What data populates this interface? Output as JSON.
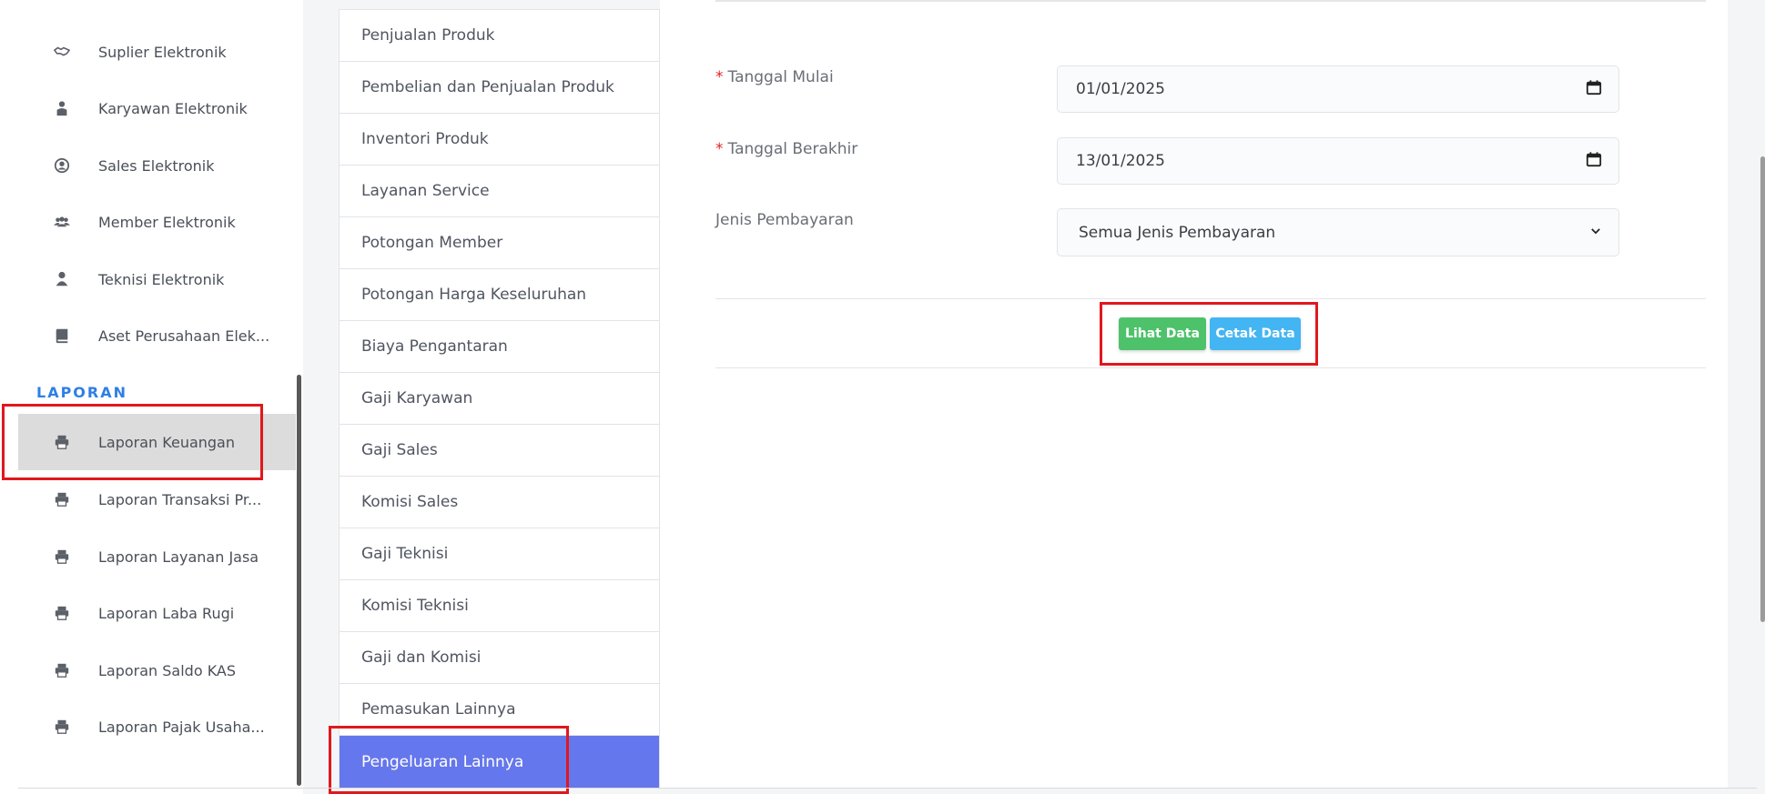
{
  "sidebar": {
    "section_label": "LAPORAN",
    "master_items": [
      {
        "label": "Suplier Elektronik",
        "icon": "handshake-icon"
      },
      {
        "label": "Karyawan Elektronik",
        "icon": "employee-icon"
      },
      {
        "label": "Sales Elektronik",
        "icon": "user-circle-icon"
      },
      {
        "label": "Member Elektronik",
        "icon": "users-icon"
      },
      {
        "label": "Teknisi Elektronik",
        "icon": "user-icon"
      },
      {
        "label": "Aset Perusahaan Elek...",
        "icon": "book-icon"
      }
    ],
    "report_items": [
      {
        "label": "Laporan Keuangan",
        "icon": "printer-icon",
        "active": true
      },
      {
        "label": "Laporan Transaksi Pr...",
        "icon": "printer-icon"
      },
      {
        "label": "Laporan Layanan Jasa",
        "icon": "printer-icon"
      },
      {
        "label": "Laporan Laba Rugi",
        "icon": "printer-icon"
      },
      {
        "label": "Laporan Saldo KAS",
        "icon": "printer-icon"
      },
      {
        "label": "Laporan Pajak Usaha...",
        "icon": "printer-icon"
      }
    ]
  },
  "report_list": {
    "items": [
      "Penjualan Produk",
      "Pembelian dan Penjualan Produk",
      "Inventori Produk",
      "Layanan Service",
      "Potongan Member",
      "Potongan Harga Keseluruhan",
      "Biaya Pengantaran",
      "Gaji Karyawan",
      "Gaji Sales",
      "Komisi Sales",
      "Gaji Teknisi",
      "Komisi Teknisi",
      "Gaji dan Komisi",
      "Pemasukan Lainnya",
      "Pengeluaran Lainnya"
    ],
    "active_item": "Pengeluaran Lainnya"
  },
  "form": {
    "required_mark": "*",
    "start_date_label": "Tanggal Mulai",
    "start_date_value": "01/01/2025",
    "end_date_label": "Tanggal Berakhir",
    "end_date_value": "13/01/2025",
    "payment_type_label": "Jenis Pembayaran",
    "payment_type_value": "Semua Jenis Pembayaran",
    "view_button": "Lihat Data",
    "print_button": "Cetak Data"
  },
  "colors": {
    "section_accent": "#2f7ee6",
    "active_report": "#6577ec",
    "view_button": "#4ec26a",
    "print_button": "#43b5f2",
    "highlight": "#e0181d",
    "required": "#e02424"
  }
}
